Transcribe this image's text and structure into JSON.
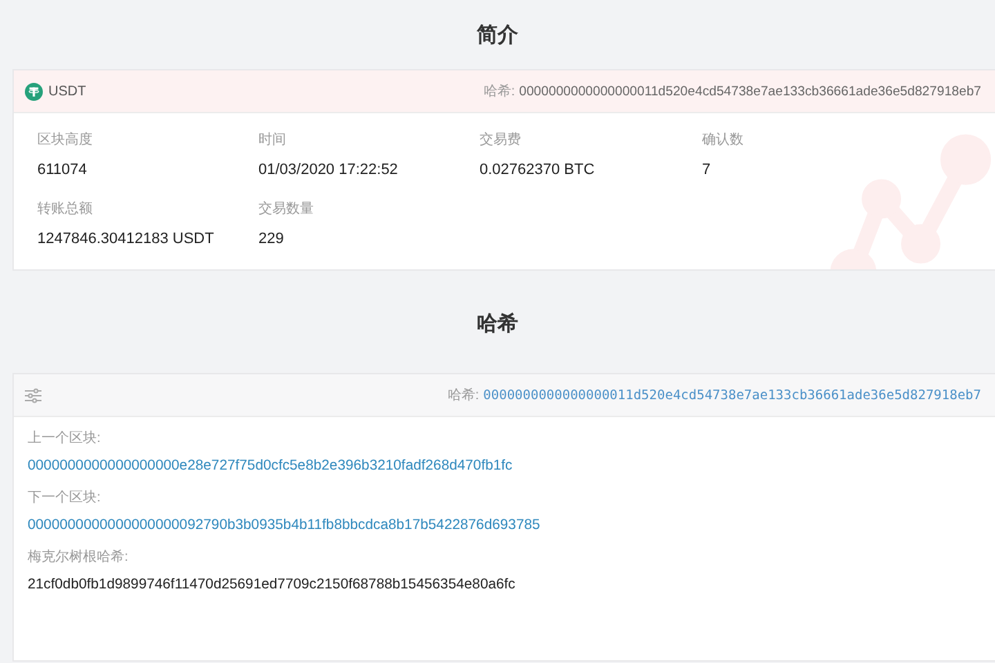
{
  "summary": {
    "title": "简介",
    "coin": "USDT",
    "hash_label": "哈希:",
    "hash": "0000000000000000011d520e4cd54738e7ae133cb36661ade36e5d827918eb7",
    "fields": [
      {
        "label": "区块高度",
        "value": "611074"
      },
      {
        "label": "时间",
        "value": "01/03/2020 17:22:52"
      },
      {
        "label": "交易费",
        "value": "0.02762370 BTC"
      },
      {
        "label": "确认数",
        "value": "7"
      },
      {
        "label": "转账总额",
        "value": "1247846.30412183 USDT"
      },
      {
        "label": "交易数量",
        "value": "229"
      }
    ]
  },
  "hash_section": {
    "title": "哈希",
    "hash_label": "哈希:",
    "hash": "0000000000000000011d520e4cd54738e7ae133cb36661ade36e5d827918eb7",
    "entries": [
      {
        "label": "上一个区块:",
        "value": "0000000000000000000e28e727f75d0cfc5e8b2e396b3210fadf268d470fb1fc",
        "kind": "link"
      },
      {
        "label": "下一个区块:",
        "value": "0000000000000000000092790b3b0935b4b11fb8bbcdca8b17b5422876d693785",
        "kind": "link"
      },
      {
        "label": "梅克尔树根哈希:",
        "value": "21cf0db0fb1d9899746f11470d25691ed7709c2150f68788b15456354e80a6fc",
        "kind": "text"
      }
    ]
  }
}
